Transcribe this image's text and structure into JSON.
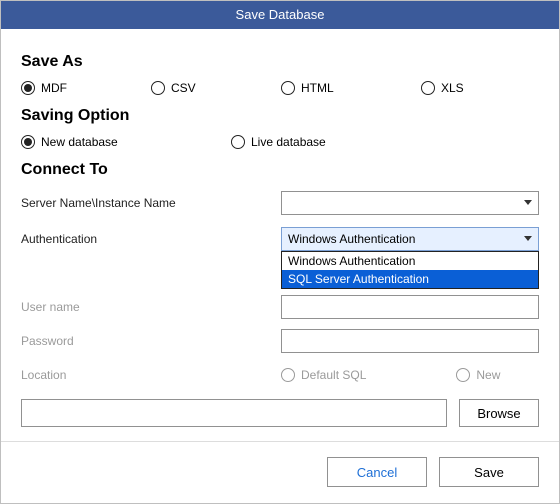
{
  "title": "Save Database",
  "sections": {
    "save_as": "Save As",
    "saving_option": "Saving Option",
    "connect_to": "Connect To"
  },
  "save_as_options": {
    "mdf": "MDF",
    "csv": "CSV",
    "html": "HTML",
    "xls": "XLS"
  },
  "saving_options": {
    "new_db": "New database",
    "live_db": "Live database"
  },
  "labels": {
    "server_name": "Server Name\\Instance Name",
    "authentication": "Authentication",
    "user_name": "User name",
    "password": "Password",
    "location": "Location"
  },
  "auth": {
    "selected": "Windows Authentication",
    "options": [
      "Windows Authentication",
      "SQL Server Authentication"
    ]
  },
  "location_options": {
    "default_sql": "Default SQL",
    "new": "New"
  },
  "buttons": {
    "browse": "Browse",
    "cancel": "Cancel",
    "save": "Save"
  }
}
